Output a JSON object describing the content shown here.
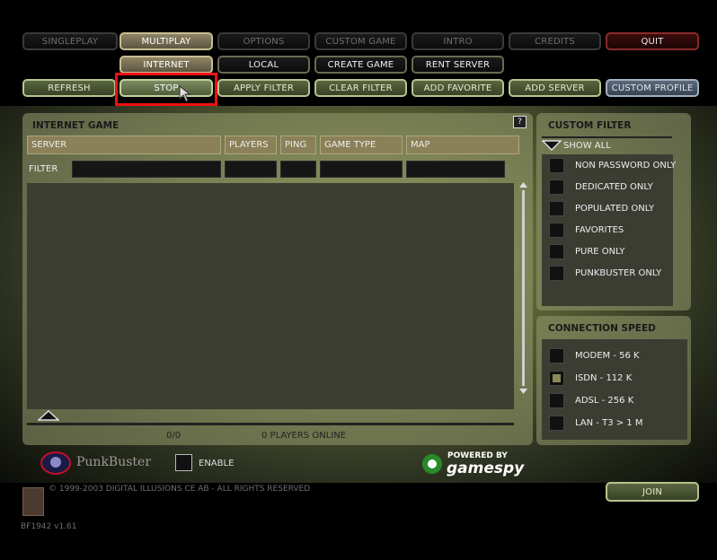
{
  "nav": {
    "singleplay": "SINGLEPLAY",
    "multiplay": "MULTIPLAY",
    "options": "OPTIONS",
    "custom_game": "CUSTOM GAME",
    "intro": "INTRO",
    "credits": "CREDITS",
    "quit": "QUIT"
  },
  "subnav": {
    "internet": "INTERNET",
    "local": "LOCAL",
    "create_game": "CREATE GAME",
    "rent_server": "RENT SERVER"
  },
  "toolbar": {
    "refresh": "REFRESH",
    "stop": "STOP",
    "apply_filter": "APPLY FILTER",
    "clear_filter": "CLEAR FILTER",
    "add_favorite": "ADD FAVORITE",
    "add_server": "ADD SERVER",
    "custom_profile": "CUSTOM PROFILE"
  },
  "browser": {
    "title": "INTERNET GAME",
    "help": "?",
    "columns": [
      "SERVER",
      "PLAYERS",
      "PING",
      "GAME TYPE",
      "MAP"
    ],
    "filter_label": "FILTER",
    "count": "0/0",
    "players_online": "0 PLAYERS ONLINE"
  },
  "custom_filter": {
    "title": "CUSTOM FILTER",
    "show_all": "SHOW ALL",
    "options": [
      {
        "label": "NON PASSWORD ONLY",
        "checked": false
      },
      {
        "label": "DEDICATED ONLY",
        "checked": false
      },
      {
        "label": "POPULATED ONLY",
        "checked": false
      },
      {
        "label": "FAVORITES",
        "checked": false
      },
      {
        "label": "PURE ONLY",
        "checked": false
      },
      {
        "label": "PUNKBUSTER ONLY",
        "checked": false
      }
    ]
  },
  "connection_speed": {
    "title": "CONNECTION SPEED",
    "options": [
      {
        "label": "MODEM - 56 K",
        "checked": false
      },
      {
        "label": "ISDN - 112 K",
        "checked": true
      },
      {
        "label": "ADSL - 256 K",
        "checked": false
      },
      {
        "label": "LAN - T3 > 1 M",
        "checked": false
      }
    ]
  },
  "footer": {
    "punkbuster": "PunkBuster",
    "enable": "ENABLE",
    "powered_by": "POWERED BY",
    "gamespy": "gamespy",
    "copyright": "© 1999-2003 DIGITAL ILLUSIONS CE AB - ALL RIGHTS RESERVED",
    "version": "BF1942 v1.61",
    "join": "JOIN"
  },
  "colors": {
    "highlight": "#ee1111",
    "accent": "#8a8158"
  }
}
